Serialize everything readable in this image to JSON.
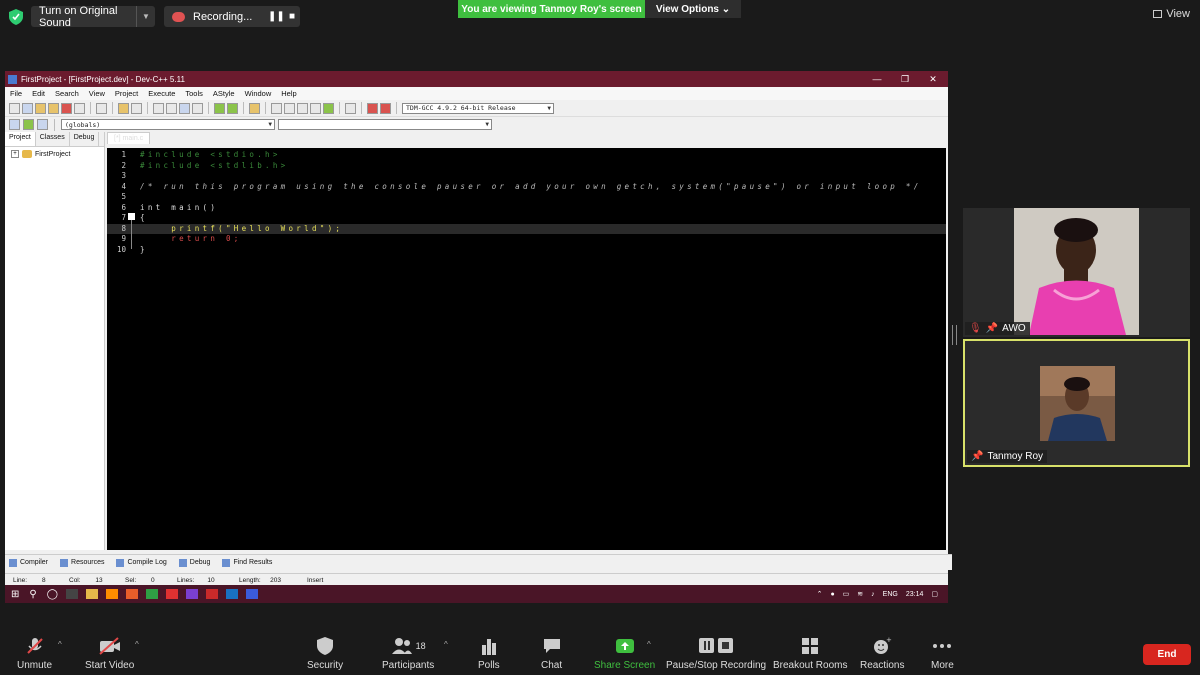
{
  "top": {
    "original_sound": "Turn on Original Sound",
    "recording": "Recording...",
    "viewing_banner": "You are viewing Tanmoy Roy's screen",
    "view_options": "View Options",
    "view": "View"
  },
  "ide": {
    "title": "FirstProject - [FirstProject.dev] - Dev-C++ 5.11",
    "menu": [
      "File",
      "Edit",
      "Search",
      "View",
      "Project",
      "Execute",
      "Tools",
      "AStyle",
      "Window",
      "Help"
    ],
    "compiler": "TDM-GCC 4.9.2 64-bit Release",
    "scope": "(globals)",
    "panel_tabs": [
      "Project",
      "Classes",
      "Debug"
    ],
    "tree_root": "FirstProject",
    "editor_tab": "[*] main.c",
    "lines": [
      {
        "n": "1",
        "text": "#include <stdio.h>"
      },
      {
        "n": "2",
        "text": "#include <stdlib.h>"
      },
      {
        "n": "3",
        "text": ""
      },
      {
        "n": "4",
        "text": "/* run this program using the console pauser or add your own getch, system(\"pause\") or input loop */"
      },
      {
        "n": "5",
        "text": ""
      },
      {
        "n": "6",
        "text": "int main()"
      },
      {
        "n": "7",
        "text": "{"
      },
      {
        "n": "8",
        "text": "    printf(\"Hello World\");"
      },
      {
        "n": "9",
        "text": "    return 0;"
      },
      {
        "n": "10",
        "text": "}"
      }
    ],
    "bottom_tabs": [
      "Compiler",
      "Resources",
      "Compile Log",
      "Debug",
      "Find Results"
    ],
    "status": {
      "line_label": "Line:",
      "line": "8",
      "col_label": "Col:",
      "col": "13",
      "sel_label": "Sel:",
      "sel": "0",
      "lines_label": "Lines:",
      "lines": "10",
      "length_label": "Length:",
      "length": "203",
      "mode": "Insert"
    },
    "taskbar": {
      "lang": "ENG",
      "time": "23:14"
    }
  },
  "participants": [
    {
      "name": "AWO"
    },
    {
      "name": "Tanmoy Roy"
    }
  ],
  "controls": {
    "unmute": "Unmute",
    "start_video": "Start Video",
    "security": "Security",
    "participants": "Participants",
    "participants_count": "18",
    "polls": "Polls",
    "chat": "Chat",
    "share_screen": "Share Screen",
    "pause_stop": "Pause/Stop Recording",
    "breakout": "Breakout Rooms",
    "reactions": "Reactions",
    "more": "More",
    "end": "End"
  },
  "colors": {
    "banner": "#3fbf3f",
    "end": "#d8261f",
    "title_bar": "#6b1b2e",
    "share": "#3fbf3f"
  }
}
